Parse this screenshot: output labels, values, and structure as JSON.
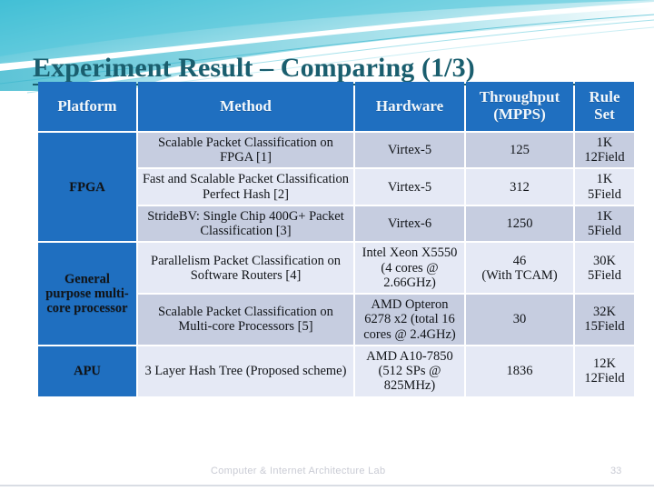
{
  "slide": {
    "title": "Experiment Result – Comparing (1/3)",
    "footer_note": "Computer & Internet Architecture Lab",
    "page_number": "33",
    "colors": {
      "title": "#1A5E6E",
      "header_blue": "#1F6FC0",
      "band_dark": "#C6CDE0",
      "band_light": "#E5E9F5",
      "swoosh_teal": "#35BBD0",
      "footer_gray": "#C9CBD4"
    }
  },
  "table": {
    "columns": [
      "Platform",
      "Method",
      "Hardware",
      "Throughput (MPPS)",
      "Rule Set"
    ],
    "headers": {
      "platform": "Platform",
      "method": "Method",
      "hardware": "Hardware",
      "throughput_line1": "Throughput",
      "throughput_line2": "(MPPS)",
      "rule_line1": "Rule",
      "rule_line2": "Set"
    },
    "platforms": [
      {
        "label": "FPGA",
        "rowspan": 3
      },
      {
        "label": "General purpose multi-core processor",
        "rowspan": 2
      },
      {
        "label": "APU",
        "rowspan": 1
      }
    ],
    "rows": [
      {
        "method": "Scalable Packet Classification on FPGA [1]",
        "hardware": "Virtex-5",
        "throughput": "125",
        "rule_set_line1": "1K",
        "rule_set_line2": "12Field"
      },
      {
        "method": "Fast and Scalable Packet Classification Perfect Hash [2]",
        "hardware": "Virtex-5",
        "throughput": "312",
        "rule_set_line1": "1K",
        "rule_set_line2": "5Field"
      },
      {
        "method": "StrideBV: Single Chip 400G+ Packet Classification [3]",
        "hardware": "Virtex-6",
        "throughput": "1250",
        "rule_set_line1": "1K",
        "rule_set_line2": "5Field"
      },
      {
        "method": "Parallelism Packet Classification on Software Routers [4]",
        "hardware": "Intel Xeon X5550 (4 cores @ 2.66GHz)",
        "throughput_line1": "46",
        "throughput_line2": "(With TCAM)",
        "rule_set_line1": "30K",
        "rule_set_line2": "5Field"
      },
      {
        "method": "Scalable Packet Classification on Multi-core Processors [5]",
        "hardware": "AMD Opteron 6278 x2 (total 16 cores @ 2.4GHz)",
        "throughput": "30",
        "rule_set_line1": "32K",
        "rule_set_line2": "15Field"
      },
      {
        "method": "3 Layer Hash Tree (Proposed scheme)",
        "hardware": "AMD A10-7850 (512 SPs @ 825MHz)",
        "throughput": "1836",
        "rule_set_line1": "12K",
        "rule_set_line2": "12Field"
      }
    ]
  }
}
